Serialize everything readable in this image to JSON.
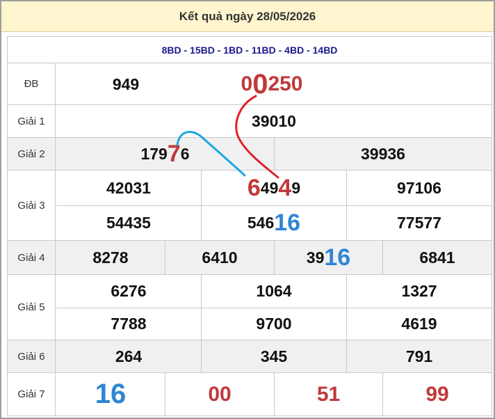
{
  "header": {
    "title": "Kết quả ngày 28/05/2026"
  },
  "provinces": "8BD - 15BD - 1BD - 11BD - 4BD - 14BD",
  "rows": {
    "db": {
      "label": "ĐB",
      "code": "949",
      "number_prefix": "0",
      "number_highlight": "0",
      "number_rest": "250"
    },
    "g1": {
      "label": "Giải 1",
      "values": [
        "39010"
      ]
    },
    "g2": {
      "label": "Giải 2",
      "values": [
        {
          "prefix": "179",
          "highlight": "7",
          "suffix": "6"
        },
        "39936"
      ]
    },
    "g3": {
      "label": "Giải 3",
      "values": [
        "42031",
        {
          "h1": "6",
          "mid": "49",
          "h2": "4",
          "suffix": "9"
        },
        "97106",
        "54435",
        {
          "prefix": "546",
          "highlight": "16"
        },
        "77577"
      ]
    },
    "g4": {
      "label": "Giải 4",
      "values": [
        "8278",
        "6410",
        {
          "prefix": "39",
          "highlight": "16"
        },
        "6841"
      ]
    },
    "g5": {
      "label": "Giải 5",
      "values": [
        "6276",
        "1064",
        "1327",
        "7788",
        "9700",
        "4619"
      ]
    },
    "g6": {
      "label": "Giải 6",
      "values": [
        "264",
        "345",
        "791"
      ]
    },
    "g7": {
      "label": "Giải 7",
      "values": [
        "16",
        "00",
        "51",
        "99"
      ]
    }
  },
  "colors": {
    "highlight_red": "#c0393b",
    "highlight_blue": "#2e86d4",
    "header_bg": "#fff5cf",
    "province_text": "#1a1a8c"
  }
}
